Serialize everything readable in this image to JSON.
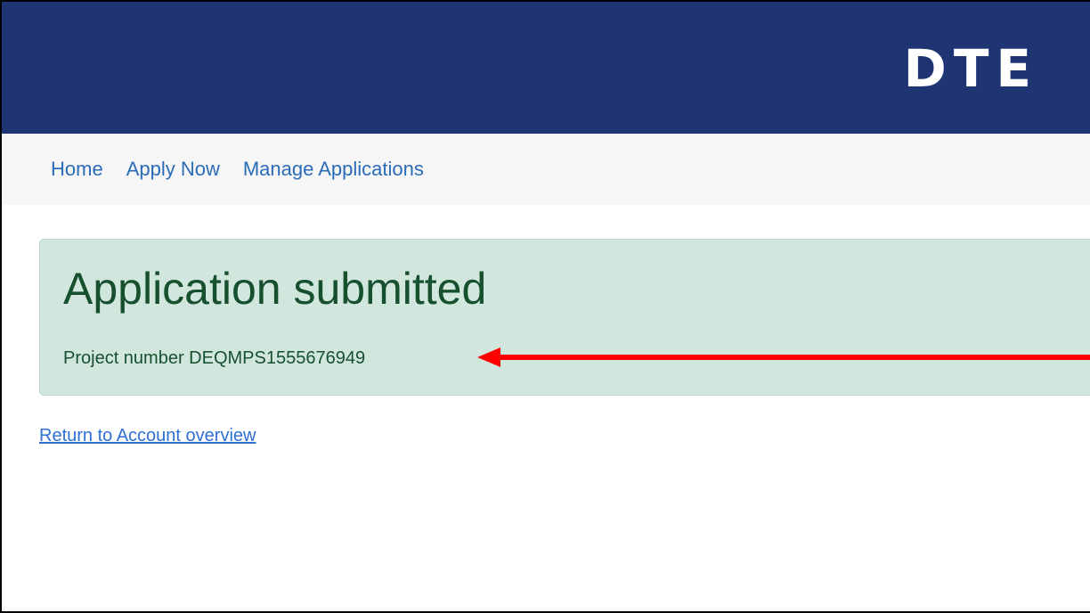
{
  "header": {
    "logo_text": "DTE",
    "background_color": "#1f3473"
  },
  "nav": {
    "items": [
      {
        "label": "Home"
      },
      {
        "label": "Apply Now"
      },
      {
        "label": "Manage Applications"
      }
    ],
    "link_color": "#2b6cb8"
  },
  "alert": {
    "title": "Application submitted",
    "project_number": "Project number DEQMPS1555676949",
    "background_color": "#d1e6dd",
    "text_color": "#17502f"
  },
  "annotation": {
    "arrow_color": "#ff0000"
  },
  "links": {
    "return_label": "Return to Account overview"
  }
}
